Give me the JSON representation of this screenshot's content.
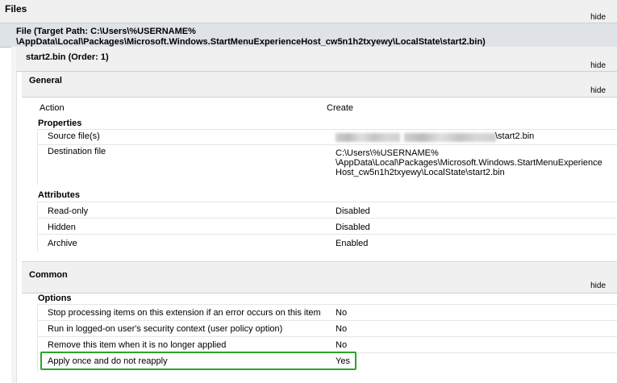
{
  "files": {
    "title": "Files",
    "hide": "hide",
    "file_header": {
      "line1": "File (Target Path: C:\\Users\\%USERNAME%",
      "line2": "\\AppData\\Local\\Packages\\Microsoft.Windows.StartMenuExperienceHost_cw5n1h2txyewy\\LocalState\\start2.bin)"
    }
  },
  "item": {
    "title": "start2.bin (Order: 1)",
    "hide": "hide"
  },
  "general": {
    "title": "General",
    "hide": "hide",
    "action_label": "Action",
    "action_value": "Create",
    "properties_title": "Properties",
    "source_label": "Source file(s)",
    "source_value_suffix": "\\start2.bin",
    "destination_label": "Destination file",
    "destination_lines": [
      "C:\\Users\\%USERNAME%",
      "\\AppData\\Local\\Packages\\Microsoft.Windows.StartMenuExperience",
      "Host_cw5n1h2txyewy\\LocalState\\start2.bin"
    ],
    "attributes_title": "Attributes",
    "attributes": [
      {
        "label": "Read-only",
        "value": "Disabled"
      },
      {
        "label": "Hidden",
        "value": "Disabled"
      },
      {
        "label": "Archive",
        "value": "Enabled"
      }
    ]
  },
  "common": {
    "title": "Common",
    "hide": "hide",
    "options_title": "Options",
    "options": [
      {
        "label": "Stop processing items on this extension if an error occurs on this item",
        "value": "No"
      },
      {
        "label": "Run in logged-on user's security context (user policy option)",
        "value": "No"
      },
      {
        "label": "Remove this item when it is no longer applied",
        "value": "No"
      },
      {
        "label": "Apply once and do not reapply",
        "value": "Yes"
      }
    ]
  },
  "colors": {
    "highlight": "#2aa52a",
    "section_band": "#f0f0f0"
  }
}
